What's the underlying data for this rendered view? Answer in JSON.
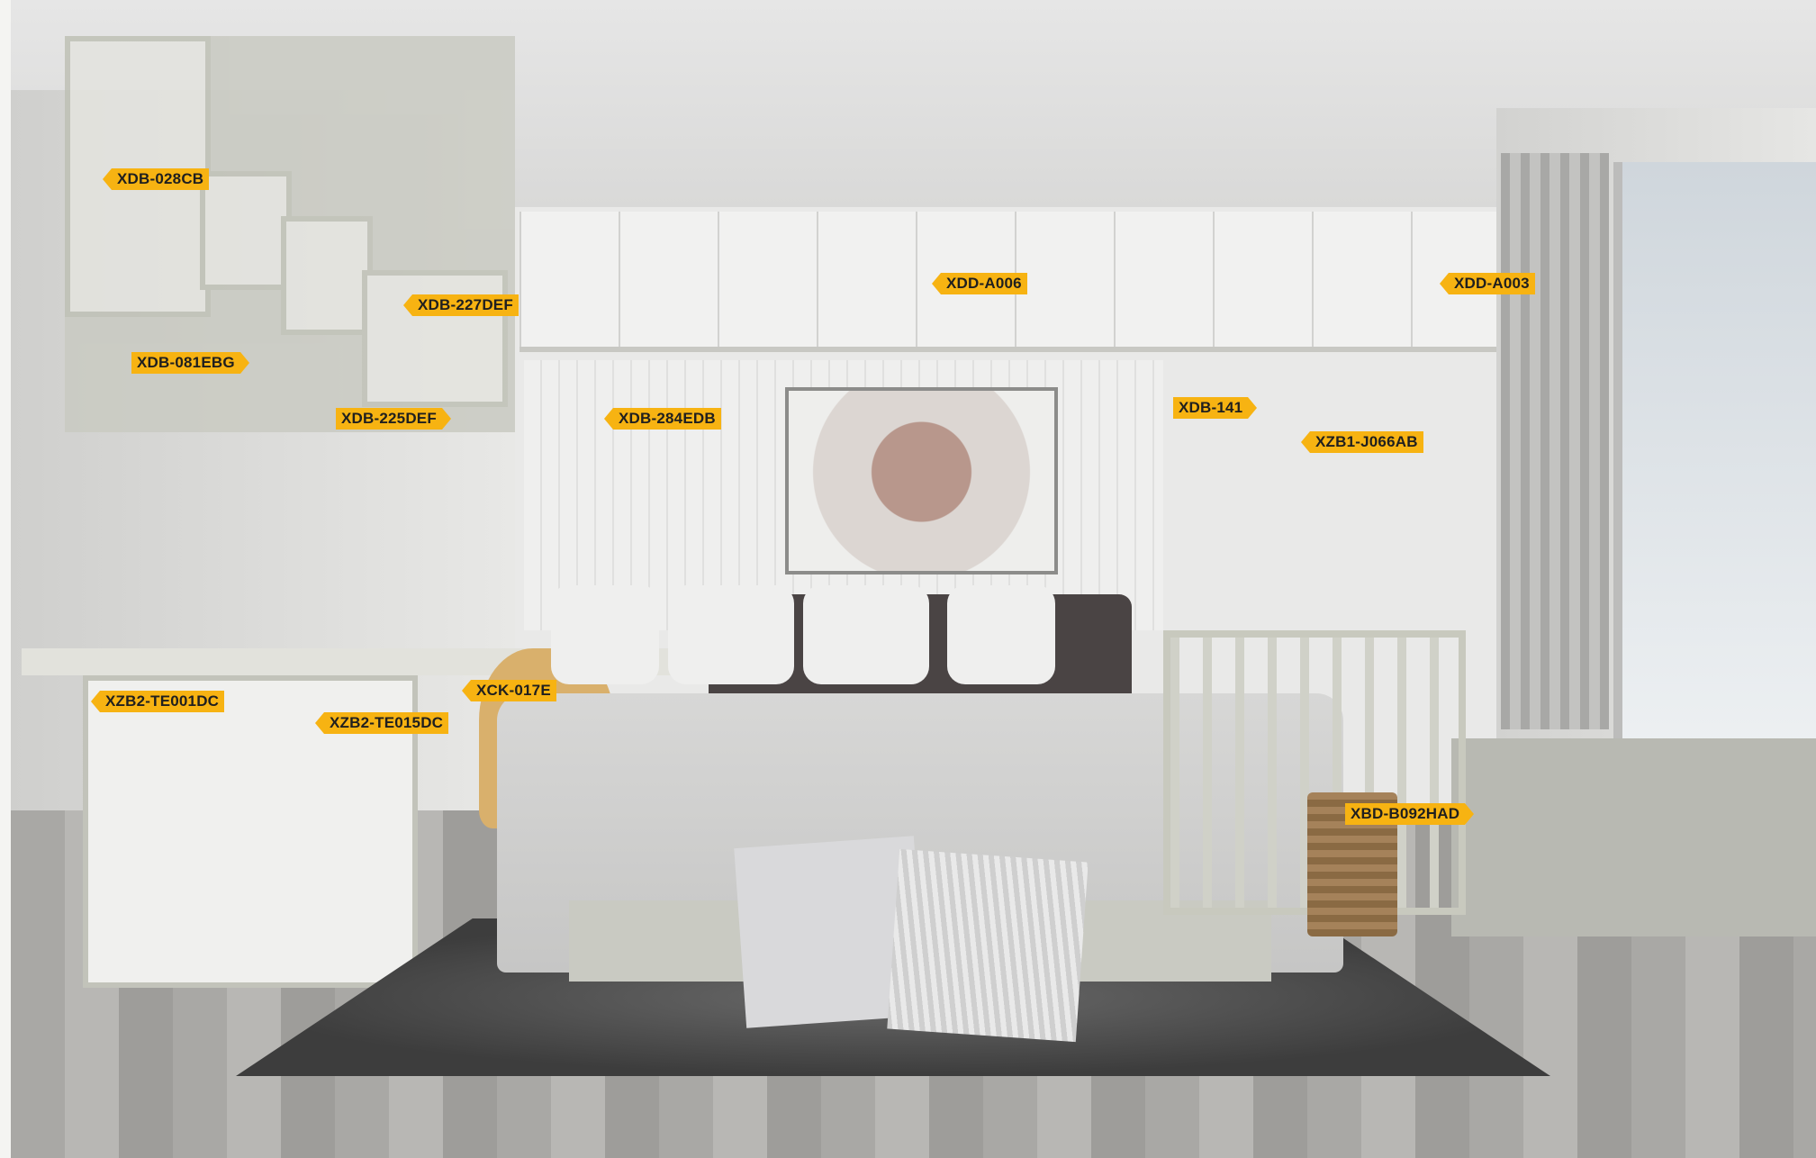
{
  "image": {
    "alt_subject": "bedroom interior with product code labels"
  },
  "labels": [
    {
      "code": "XDB-028CB"
    },
    {
      "code": "XDB-227DEF"
    },
    {
      "code": "XDB-081EBG"
    },
    {
      "code": "XDB-225DEF"
    },
    {
      "code": "XDB-284EDB"
    },
    {
      "code": "XDD-A006"
    },
    {
      "code": "XDD-A003"
    },
    {
      "code": "XDB-141"
    },
    {
      "code": "XZB1-J066AB"
    },
    {
      "code": "XCK-017E"
    },
    {
      "code": "XZB2-TE001DC"
    },
    {
      "code": "XZB2-TE015DC"
    },
    {
      "code": "XBD-B092HAD"
    }
  ]
}
